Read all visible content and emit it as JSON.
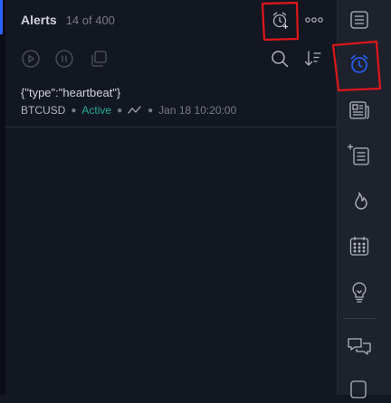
{
  "header": {
    "title": "Alerts",
    "count": "14 of 400"
  },
  "alerts": [
    {
      "name": "{\"type\":\"heartbeat\"}",
      "symbol": "BTCUSD",
      "status": "Active",
      "time": "Jan 18 10:20:00"
    }
  ],
  "icons": {
    "add_alert": "alarm-plus-icon",
    "more": "more-horizontal-icon",
    "play": "play-circle-icon",
    "pause": "pause-circle-icon",
    "clone": "clone-icon",
    "search": "search-icon",
    "sort": "sort-icon",
    "trend": "trend-line-icon"
  },
  "sidebar": [
    {
      "icon": "watchlist-icon"
    },
    {
      "icon": "alarm-clock-icon",
      "active": true
    },
    {
      "icon": "news-icon"
    },
    {
      "icon": "ideas-stream-icon"
    },
    {
      "icon": "hotlist-fire-icon"
    },
    {
      "icon": "calendar-icon"
    },
    {
      "icon": "lightbulb-icon"
    },
    {
      "icon": "chat-icon"
    }
  ],
  "colors": {
    "background": "#131722",
    "accent": "#2962ff",
    "active_status": "#22ab94",
    "annotation": "#e0171b"
  }
}
